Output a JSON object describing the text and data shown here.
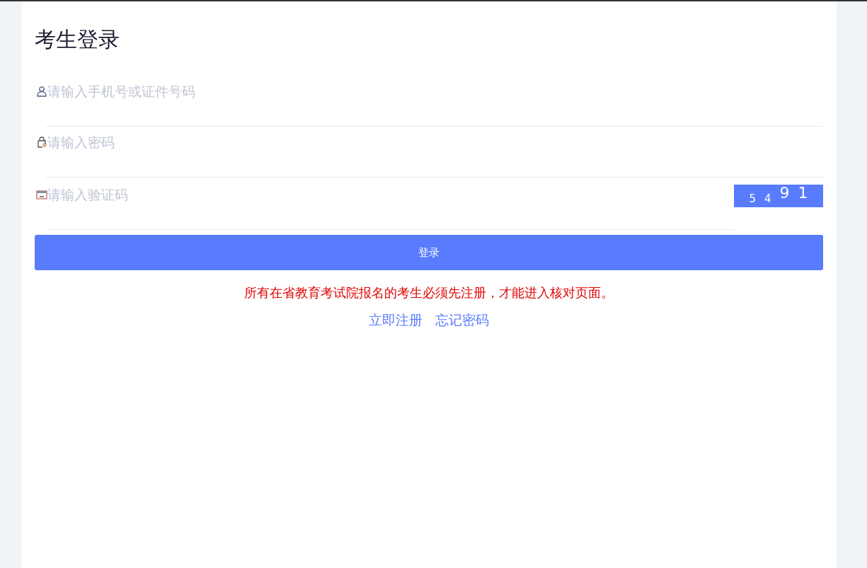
{
  "title": "考生登录",
  "fields": [
    {
      "kind": "user",
      "placeholder": "请输入手机号或证件号码"
    },
    {
      "kind": "password",
      "placeholder": "请输入密码"
    },
    {
      "kind": "captcha",
      "placeholder": "请输入验证码"
    }
  ],
  "captcha": [
    "5",
    "4",
    "9",
    "1"
  ],
  "login_button": "登录",
  "notice": "所有在省教育考试院报名的考生必须先注册，才能进入核对页面。",
  "links": [
    "立即注册",
    "忘记密码"
  ]
}
